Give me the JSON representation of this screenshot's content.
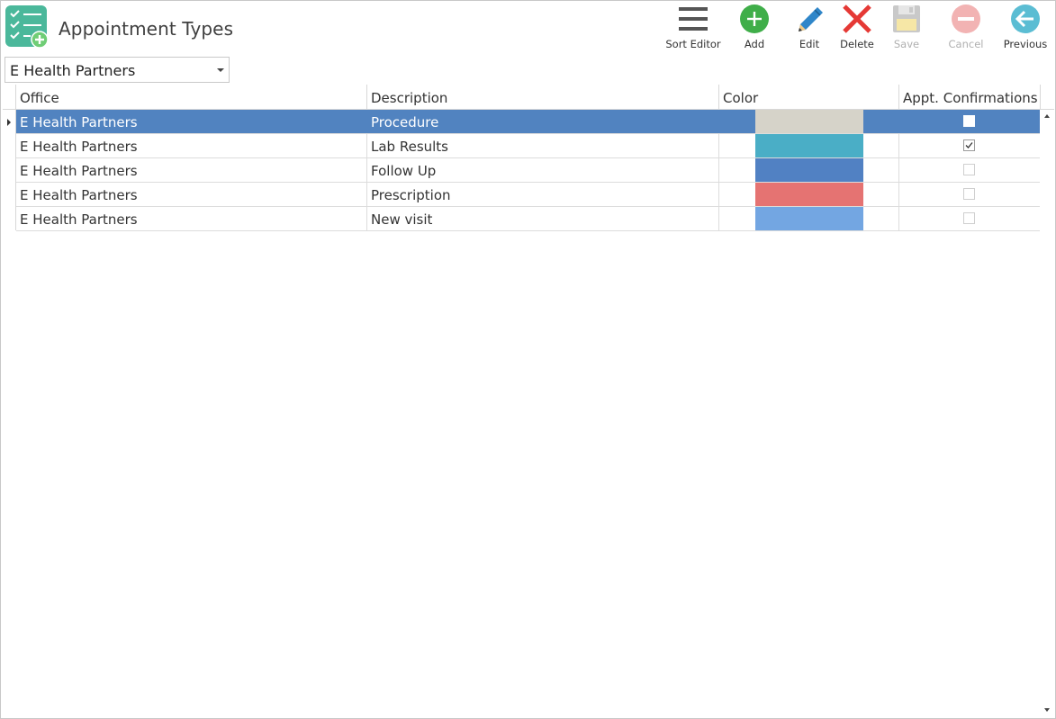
{
  "header": {
    "title": "Appointment Types"
  },
  "toolbar": {
    "buttons": [
      {
        "label": "Sort Editor",
        "icon": "hamburger-icon",
        "enabled": true
      },
      {
        "label": "Add",
        "icon": "plus-circle-icon",
        "enabled": true
      },
      {
        "label": "Edit",
        "icon": "pencil-icon",
        "enabled": true
      },
      {
        "label": "Delete",
        "icon": "x-icon",
        "enabled": true
      },
      {
        "label": "Save",
        "icon": "floppy-disk-icon",
        "enabled": false
      },
      {
        "label": "Cancel",
        "icon": "minus-circle-icon",
        "enabled": false
      },
      {
        "label": "Previous",
        "icon": "arrow-left-circle-icon",
        "enabled": true
      }
    ]
  },
  "office_select": {
    "value": "E Health Partners"
  },
  "grid": {
    "columns": [
      "Office",
      "Description",
      "Color",
      "Appt. Confirmations"
    ],
    "rows": [
      {
        "office": "E Health Partners",
        "description": "Procedure",
        "color": "#d6d3c9",
        "confirmations": false,
        "selected": true
      },
      {
        "office": "E Health Partners",
        "description": "Lab Results",
        "color": "#4aaec6",
        "confirmations": true,
        "selected": false
      },
      {
        "office": "E Health Partners",
        "description": "Follow Up",
        "color": "#5181c3",
        "confirmations": false,
        "selected": false
      },
      {
        "office": "E Health Partners",
        "description": "Prescription",
        "color": "#e57372",
        "confirmations": false,
        "selected": false
      },
      {
        "office": "E Health Partners",
        "description": "New visit",
        "color": "#73a6e2",
        "confirmations": false,
        "selected": false
      }
    ]
  },
  "colors": {
    "selection": "#5183c0",
    "app_icon": "#4bb89b",
    "add": "#3fae49",
    "edit": "#2f86c9",
    "delete": "#e53935",
    "previous": "#5bbdd3",
    "disabled_icon": "#c9c9c9",
    "disabled_cancel": "#f2b3b3"
  }
}
